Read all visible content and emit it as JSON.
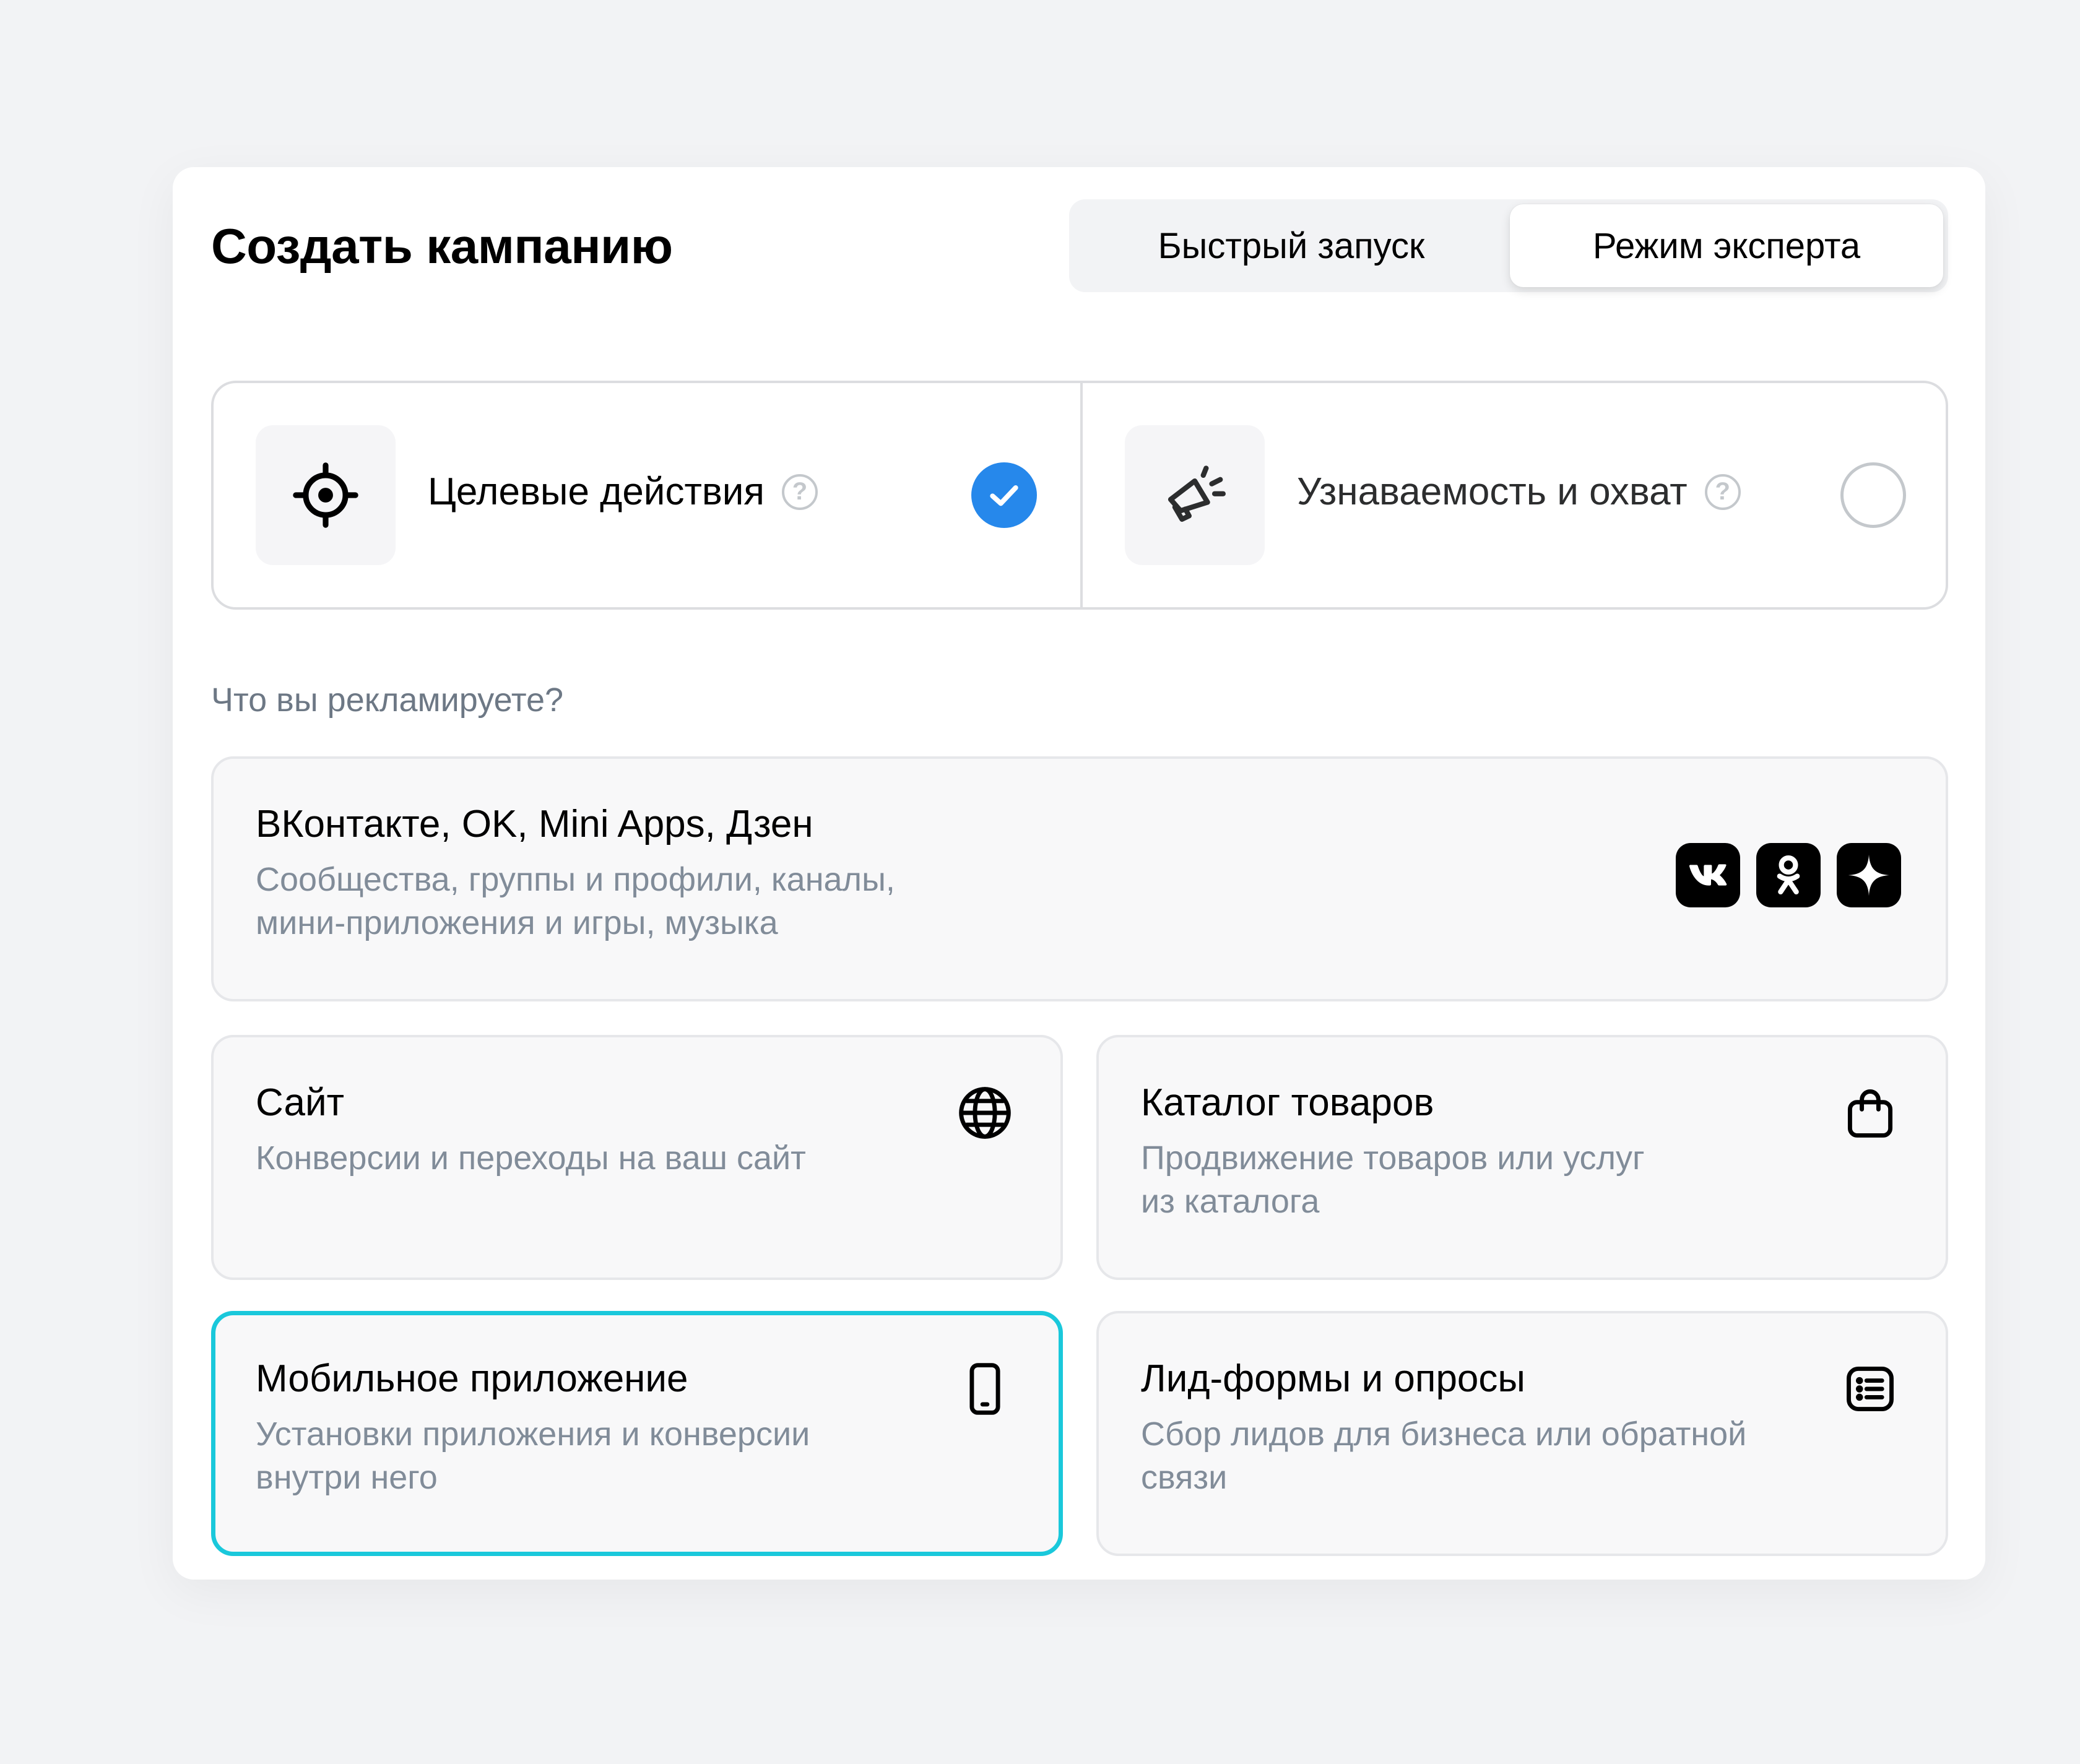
{
  "header": {
    "title": "Создать кампанию",
    "mode_switch": {
      "options": [
        {
          "label": "Быстрый запуск",
          "selected": false
        },
        {
          "label": "Режим эксперта",
          "selected": true
        }
      ]
    }
  },
  "goals": [
    {
      "label": "Целевые действия",
      "icon": "crosshair-icon",
      "selected": true
    },
    {
      "label": "Узнаваемость и охват",
      "icon": "megaphone-icon",
      "selected": false
    }
  ],
  "question": "Что вы рекламируете?",
  "cards": {
    "vk": {
      "title": "ВКонтакте, OK, Mini Apps, Дзен",
      "desc_line1": "Сообщества, группы и профили, каналы,",
      "desc_line2": "мини-приложения и игры, музыка",
      "icons": [
        "vk-logo-icon",
        "ok-logo-icon",
        "dzen-logo-icon"
      ]
    },
    "site": {
      "title": "Сайт",
      "desc_line1": "Конверсии и переходы на ваш сайт",
      "icon": "globe-icon"
    },
    "catalog": {
      "title": "Каталог товаров",
      "desc_line1": "Продвижение товаров или услуг",
      "desc_line2": "из каталога",
      "icon": "shopping-bag-icon"
    },
    "mobile": {
      "title": "Мобильное приложение",
      "desc_line1": "Установки приложения и конверсии",
      "desc_line2": "внутри него",
      "icon": "smartphone-icon",
      "highlighted": true,
      "highlight_color": "#1ac8db"
    },
    "leads": {
      "title": "Лид-формы и опросы",
      "desc_line1": "Сбор лидов для бизнеса или обратной",
      "desc_line2": "связи",
      "icon": "list-form-icon"
    }
  },
  "colors": {
    "accent": "#2688eb",
    "highlight": "#1ac8db",
    "muted_text": "#818c99"
  }
}
